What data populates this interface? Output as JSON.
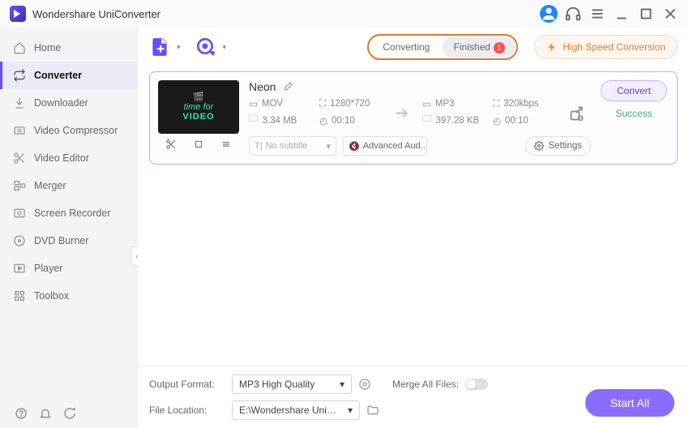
{
  "app": {
    "title": "Wondershare UniConverter"
  },
  "sidebar": {
    "items": [
      {
        "label": "Home"
      },
      {
        "label": "Converter"
      },
      {
        "label": "Downloader"
      },
      {
        "label": "Video Compressor"
      },
      {
        "label": "Video Editor"
      },
      {
        "label": "Merger"
      },
      {
        "label": "Screen Recorder"
      },
      {
        "label": "DVD Burner"
      },
      {
        "label": "Player"
      },
      {
        "label": "Toolbox"
      }
    ]
  },
  "tabs": {
    "converting": "Converting",
    "finished": "Finished",
    "finished_count": "1"
  },
  "hsc": "High Speed Conversion",
  "item": {
    "title": "Neon",
    "src_format": "MOV",
    "src_res": "1280*720",
    "src_size": "3.34 MB",
    "src_dur": "00:10",
    "dst_format": "MP3",
    "dst_bitrate": "320kbps",
    "dst_size": "397.28 KB",
    "dst_dur": "00:10",
    "subtitle_placeholder": "No subtitle",
    "audio_label": "Advanced Aud...",
    "settings_label": "Settings",
    "convert_label": "Convert",
    "status": "Success"
  },
  "bottom": {
    "output_format_label": "Output Format:",
    "output_format_value": "MP3 High Quality",
    "merge_label": "Merge All Files:",
    "file_location_label": "File Location:",
    "file_location_value": "E:\\Wondershare UniConverter",
    "start_all": "Start All"
  }
}
